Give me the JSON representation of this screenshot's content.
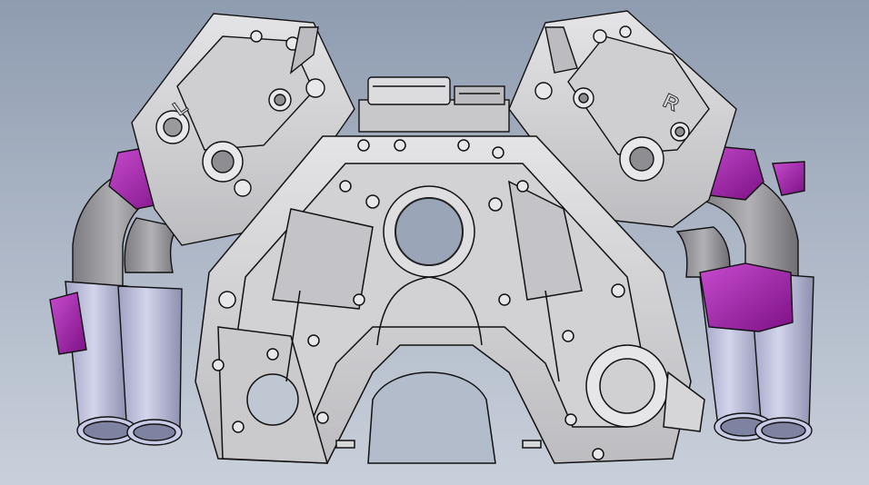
{
  "model_view": {
    "head_markings": {
      "left": "L",
      "right": "R"
    },
    "colors": {
      "background_top": "#8f9cb0",
      "background_bottom": "#c9d0db",
      "block_fill": "#d6d6d8",
      "block_shadow": "#9c9ca0",
      "edge_line": "#111111",
      "exhaust_pipe": "#b9bbd6",
      "exhaust_pipe_dark": "#8a8da8",
      "collector_gray": "#9a9a9c",
      "flange_magenta": "#a020a8"
    }
  }
}
